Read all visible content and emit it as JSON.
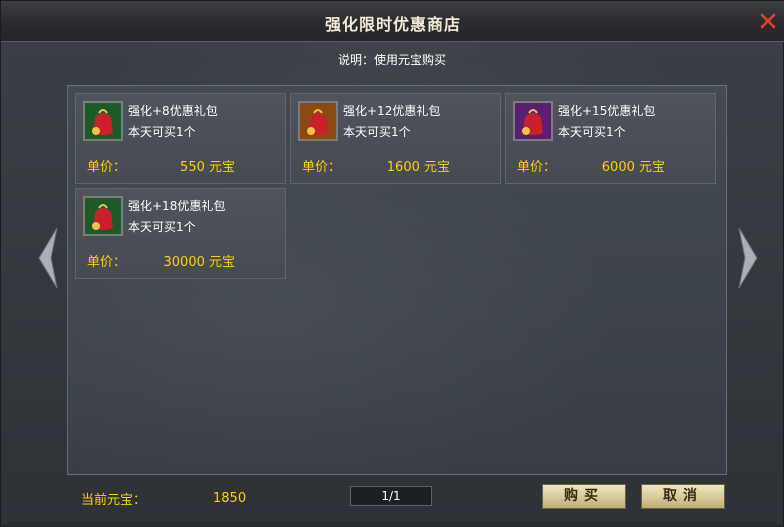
{
  "window": {
    "title": "强化限时优惠商店"
  },
  "subtitle": "说明：使用元宝购买",
  "price_label": "单价：",
  "items": [
    {
      "name": "强化+8优惠礼包",
      "limit": "本天可买1个",
      "price": "550 元宝",
      "icon": "green-gift-bag-icon",
      "icon_color": "#2f8a3a"
    },
    {
      "name": "强化+12优惠礼包",
      "limit": "本天可买1个",
      "price": "1600 元宝",
      "icon": "orange-gift-bag-icon",
      "icon_color": "#c06a1c"
    },
    {
      "name": "强化+15优惠礼包",
      "limit": "本天可买1个",
      "price": "6000 元宝",
      "icon": "purple-gift-bag-icon",
      "icon_color": "#8a2fa0"
    },
    {
      "name": "强化+18优惠礼包",
      "limit": "本天可买1个",
      "price": "30000 元宝",
      "icon": "green-gift-bag-icon",
      "icon_color": "#2f8a3a"
    }
  ],
  "footer": {
    "balance_label": "当前元宝：",
    "balance_value": "1850",
    "page": "1/1",
    "buy_label": "购买",
    "cancel_label": "取消"
  },
  "colors": {
    "price": "#ffd200",
    "close": "#e8412a"
  }
}
